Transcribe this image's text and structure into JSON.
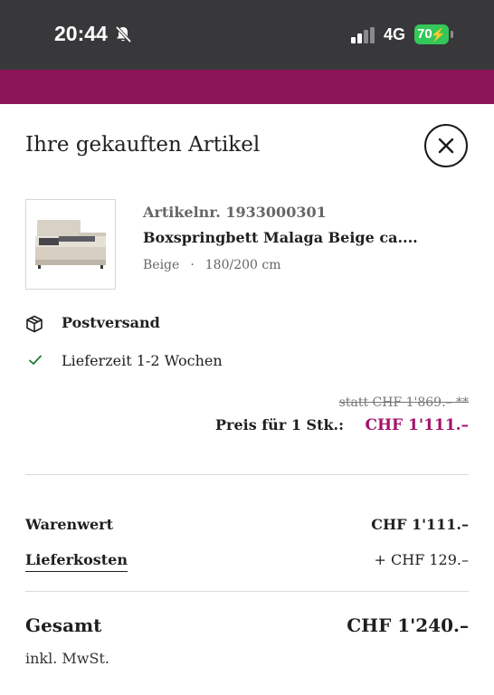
{
  "status_bar": {
    "time": "20:44",
    "network": "4G",
    "battery": "70"
  },
  "sheet": {
    "title": "Ihre gekauften Artikel"
  },
  "item": {
    "article_number": "Artikelnr. 1933000301",
    "name": "Boxspringbett Malaga Beige ca....",
    "color": "Beige",
    "separator": "·",
    "size": "180/200 cm"
  },
  "shipping": {
    "method": "Postversand",
    "delivery_time": "Lieferzeit 1-2 Wochen"
  },
  "pricing": {
    "old_price": "statt CHF 1'869.– **",
    "price_label": "Preis für 1 Stk.:",
    "price_value": "CHF 1'111.–"
  },
  "summary": {
    "goods_label": "Warenwert",
    "goods_value": "CHF 1'111.–",
    "shipping_label": "Lieferkosten",
    "shipping_value": "+ CHF 129.–",
    "total_label": "Gesamt",
    "total_value": "CHF 1'240.–",
    "vat_note": "inkl. MwSt."
  },
  "colors": {
    "brand": "#8b1458",
    "price_accent": "#a3126b",
    "battery": "#34c759"
  },
  "icons": [
    "bell-slash-icon",
    "signal-icon",
    "battery-icon",
    "close-icon",
    "package-icon",
    "check-icon"
  ]
}
